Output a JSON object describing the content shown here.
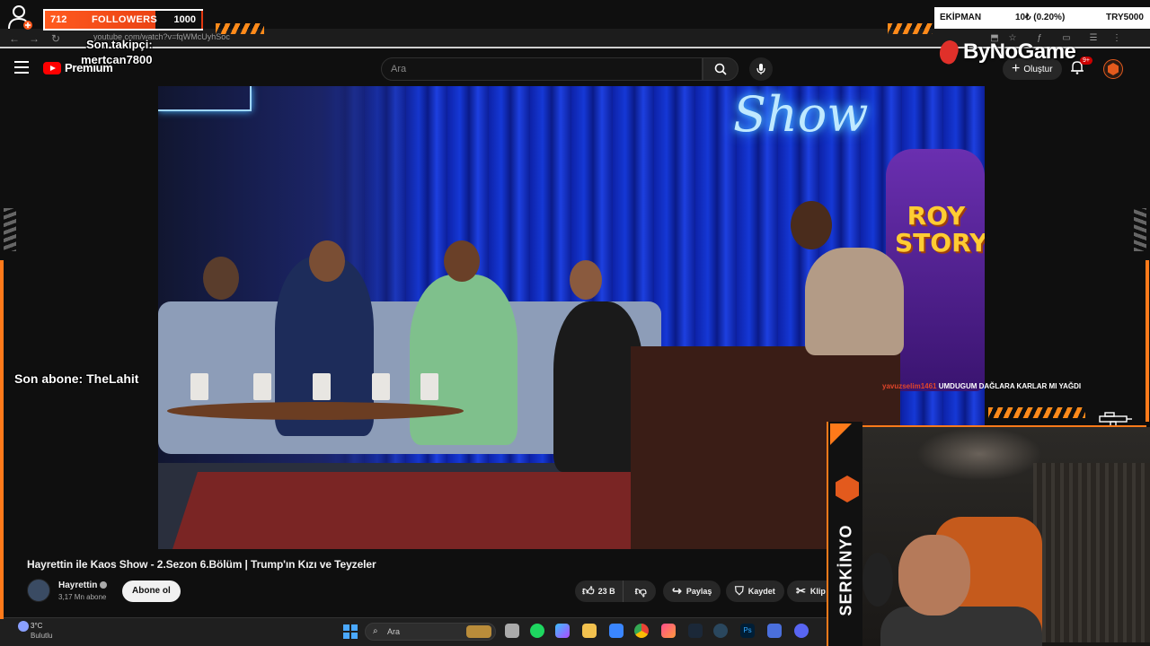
{
  "browser": {
    "url": "youtube.com/watch?v=fqWMcUyhSoc"
  },
  "header": {
    "logo_text": "Premium",
    "search_placeholder": "Ara",
    "create_label": "Oluştur",
    "notif_badge": "9+"
  },
  "video": {
    "title": "Hayrettin ile Kaos Show - 2.Sezon 6.Bölüm | Trump'ın Kızı ve Teyzeler",
    "channel": "Hayrettin",
    "subs": "3,17 Mn abone",
    "subscribe_label": "Abone ol",
    "scene_neon": "Show",
    "scene_sign": "ROY STORY"
  },
  "actions": {
    "likes": "23 B",
    "share": "Paylaş",
    "save": "Kaydet",
    "clip": "Klip"
  },
  "overlay": {
    "followers_current": "712",
    "followers_label": "FOLLOWERS",
    "followers_goal": "1000",
    "followers_progress": 0.712,
    "last_follower_label": "Son takipçi:",
    "last_follower_name": "mertcan7800",
    "last_sub_text": "Son abone: TheLahit",
    "sponsor": "ByNoGame",
    "ticker_left": "EKİPMAN",
    "ticker_mid": "10₺ (0.20%)",
    "ticker_right": "TRY5000",
    "chat_user": "yavuzselim1461",
    "chat_msg": "UMDUGUM DAĞLARA KARLAR MI YAĞDI",
    "streamer_name": "SERKİNYO",
    "accent_color": "#ff7a1a"
  },
  "taskbar": {
    "temp": "3°C",
    "weather": "Bulutlu",
    "search_placeholder": "Ara",
    "apps": [
      "explorer-icon",
      "terminal-icon",
      "spotify-icon",
      "copilot-icon",
      "folder-icon",
      "store-icon",
      "chrome-icon",
      "photos-icon",
      "steam-icon",
      "steam2-icon",
      "photoshop-icon",
      "app-icon",
      "discord-icon"
    ]
  }
}
